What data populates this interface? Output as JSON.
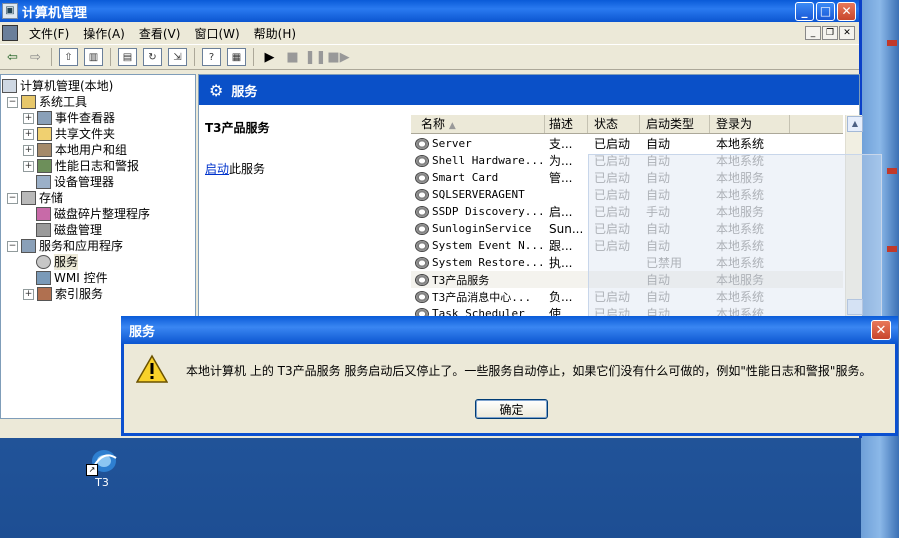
{
  "window": {
    "title": "计算机管理",
    "buttons": {
      "minimize": "_",
      "maximize": "□",
      "close": "✕"
    }
  },
  "menu": {
    "items": [
      "文件(F)",
      "操作(A)",
      "查看(V)",
      "窗口(W)",
      "帮助(H)"
    ],
    "mdi": {
      "minimize": "_",
      "restore": "❐",
      "close": "✕"
    }
  },
  "tree": {
    "root": "计算机管理(本地)",
    "nodes": [
      {
        "label": "系统工具"
      },
      {
        "label": "事件查看器"
      },
      {
        "label": "共享文件夹"
      },
      {
        "label": "本地用户和组"
      },
      {
        "label": "性能日志和警报"
      },
      {
        "label": "设备管理器"
      },
      {
        "label": "存储"
      },
      {
        "label": "磁盘碎片整理程序"
      },
      {
        "label": "磁盘管理"
      },
      {
        "label": "服务和应用程序"
      },
      {
        "label": "服务"
      },
      {
        "label": "WMI 控件"
      },
      {
        "label": "索引服务"
      }
    ]
  },
  "services_pane": {
    "header": "服务",
    "selected_title": "T3产品服务",
    "start_link": "启动",
    "start_suffix": "此服务",
    "columns": [
      "名称",
      "描述",
      "状态",
      "启动类型",
      "登录为"
    ],
    "rows": [
      [
        "Server",
        "支...",
        "已启动",
        "自动",
        "本地系统"
      ],
      [
        "Shell Hardware...",
        "为...",
        "已启动",
        "自动",
        "本地系统"
      ],
      [
        "Smart Card",
        "管...",
        "已启动",
        "自动",
        "本地服务"
      ],
      [
        "SQLSERVERAGENT",
        "",
        "已启动",
        "自动",
        "本地系统"
      ],
      [
        "SSDP Discovery...",
        "启...",
        "已启动",
        "手动",
        "本地服务"
      ],
      [
        "SunloginService",
        "Sun...",
        "已启动",
        "自动",
        "本地系统"
      ],
      [
        "System Event N...",
        "跟...",
        "已启动",
        "自动",
        "本地系统"
      ],
      [
        "System Restore...",
        "执...",
        "",
        "已禁用",
        "本地系统"
      ],
      [
        "T3产品服务",
        "",
        "",
        "自动",
        "本地服务"
      ],
      [
        "T3产品消息中心...",
        "负...",
        "已启动",
        "自动",
        "本地系统"
      ],
      [
        "Task Scheduler",
        "使...",
        "已启动",
        "自动",
        "本地系统"
      ]
    ]
  },
  "dialog": {
    "title": "服务",
    "close": "✕",
    "message": "本地计算机 上的 T3产品服务 服务启动后又停止了。一些服务自动停止，如果它们没有什么可做的，例如\"性能日志和警报\"服务。",
    "ok": "确定"
  },
  "desktop": {
    "icon_label": "T3"
  }
}
